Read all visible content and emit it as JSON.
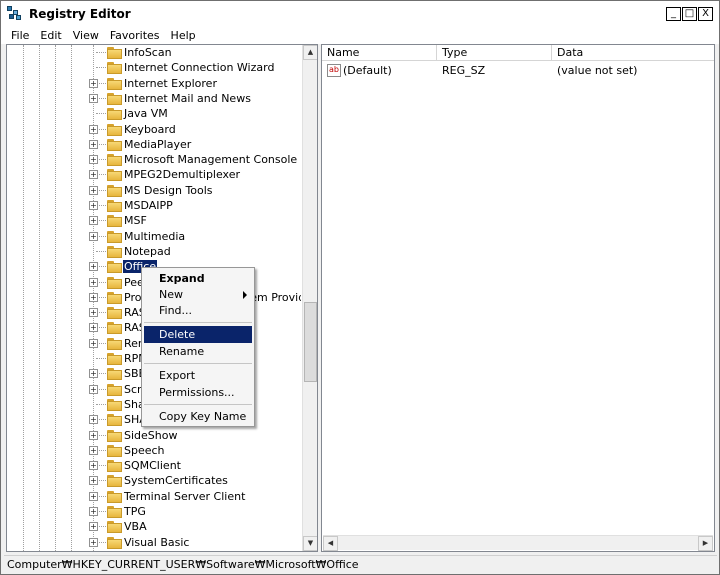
{
  "window": {
    "title": "Registry Editor",
    "min": "_",
    "max": "□",
    "close": "X"
  },
  "menu": [
    "File",
    "Edit",
    "View",
    "Favorites",
    "Help"
  ],
  "tree": [
    {
      "label": "InfoScan",
      "expandable": false
    },
    {
      "label": "Internet Connection Wizard",
      "expandable": false
    },
    {
      "label": "Internet Explorer",
      "expandable": true
    },
    {
      "label": "Internet Mail and News",
      "expandable": true
    },
    {
      "label": "Java VM",
      "expandable": false
    },
    {
      "label": "Keyboard",
      "expandable": true
    },
    {
      "label": "MediaPlayer",
      "expandable": true
    },
    {
      "label": "Microsoft Management Console",
      "expandable": true
    },
    {
      "label": "MPEG2Demultiplexer",
      "expandable": true
    },
    {
      "label": "MS Design Tools",
      "expandable": true
    },
    {
      "label": "MSDAIPP",
      "expandable": true
    },
    {
      "label": "MSF",
      "expandable": true
    },
    {
      "label": "Multimedia",
      "expandable": true
    },
    {
      "label": "Notepad",
      "expandable": false
    },
    {
      "label": "Office",
      "expandable": true,
      "selected": true
    },
    {
      "label": "Peer",
      "expandable": true
    },
    {
      "label": "Protected Storage System Provider",
      "expandable": true
    },
    {
      "label": "RAS AutoDial",
      "expandable": true
    },
    {
      "label": "RAS Phonebook",
      "expandable": true
    },
    {
      "label": "Remote Assistance",
      "expandable": true
    },
    {
      "label": "RPM",
      "expandable": false
    },
    {
      "label": "SBEngine",
      "expandable": true
    },
    {
      "label": "Scrunch",
      "expandable": true
    },
    {
      "label": "Shared",
      "expandable": false
    },
    {
      "label": "SHARED TOOLS",
      "expandable": true
    },
    {
      "label": "SideShow",
      "expandable": true
    },
    {
      "label": "Speech",
      "expandable": true
    },
    {
      "label": "SQMClient",
      "expandable": true
    },
    {
      "label": "SystemCertificates",
      "expandable": true
    },
    {
      "label": "Terminal Server Client",
      "expandable": true
    },
    {
      "label": "TPG",
      "expandable": true
    },
    {
      "label": "VBA",
      "expandable": true
    },
    {
      "label": "Visual Basic",
      "expandable": true
    }
  ],
  "list": {
    "columns": [
      "Name",
      "Type",
      "Data"
    ],
    "rows": [
      {
        "name": "(Default)",
        "type": "REG_SZ",
        "data": "(value not set)"
      }
    ]
  },
  "context_menu": {
    "expand": "Expand",
    "new": "New",
    "find": "Find...",
    "delete": "Delete",
    "rename": "Rename",
    "export": "Export",
    "permissions": "Permissions...",
    "copy_key_name": "Copy Key Name"
  },
  "status": "Computer₩HKEY_CURRENT_USER₩Software₩Microsoft₩Office",
  "icons": {
    "value": "ab",
    "expander": "+"
  }
}
